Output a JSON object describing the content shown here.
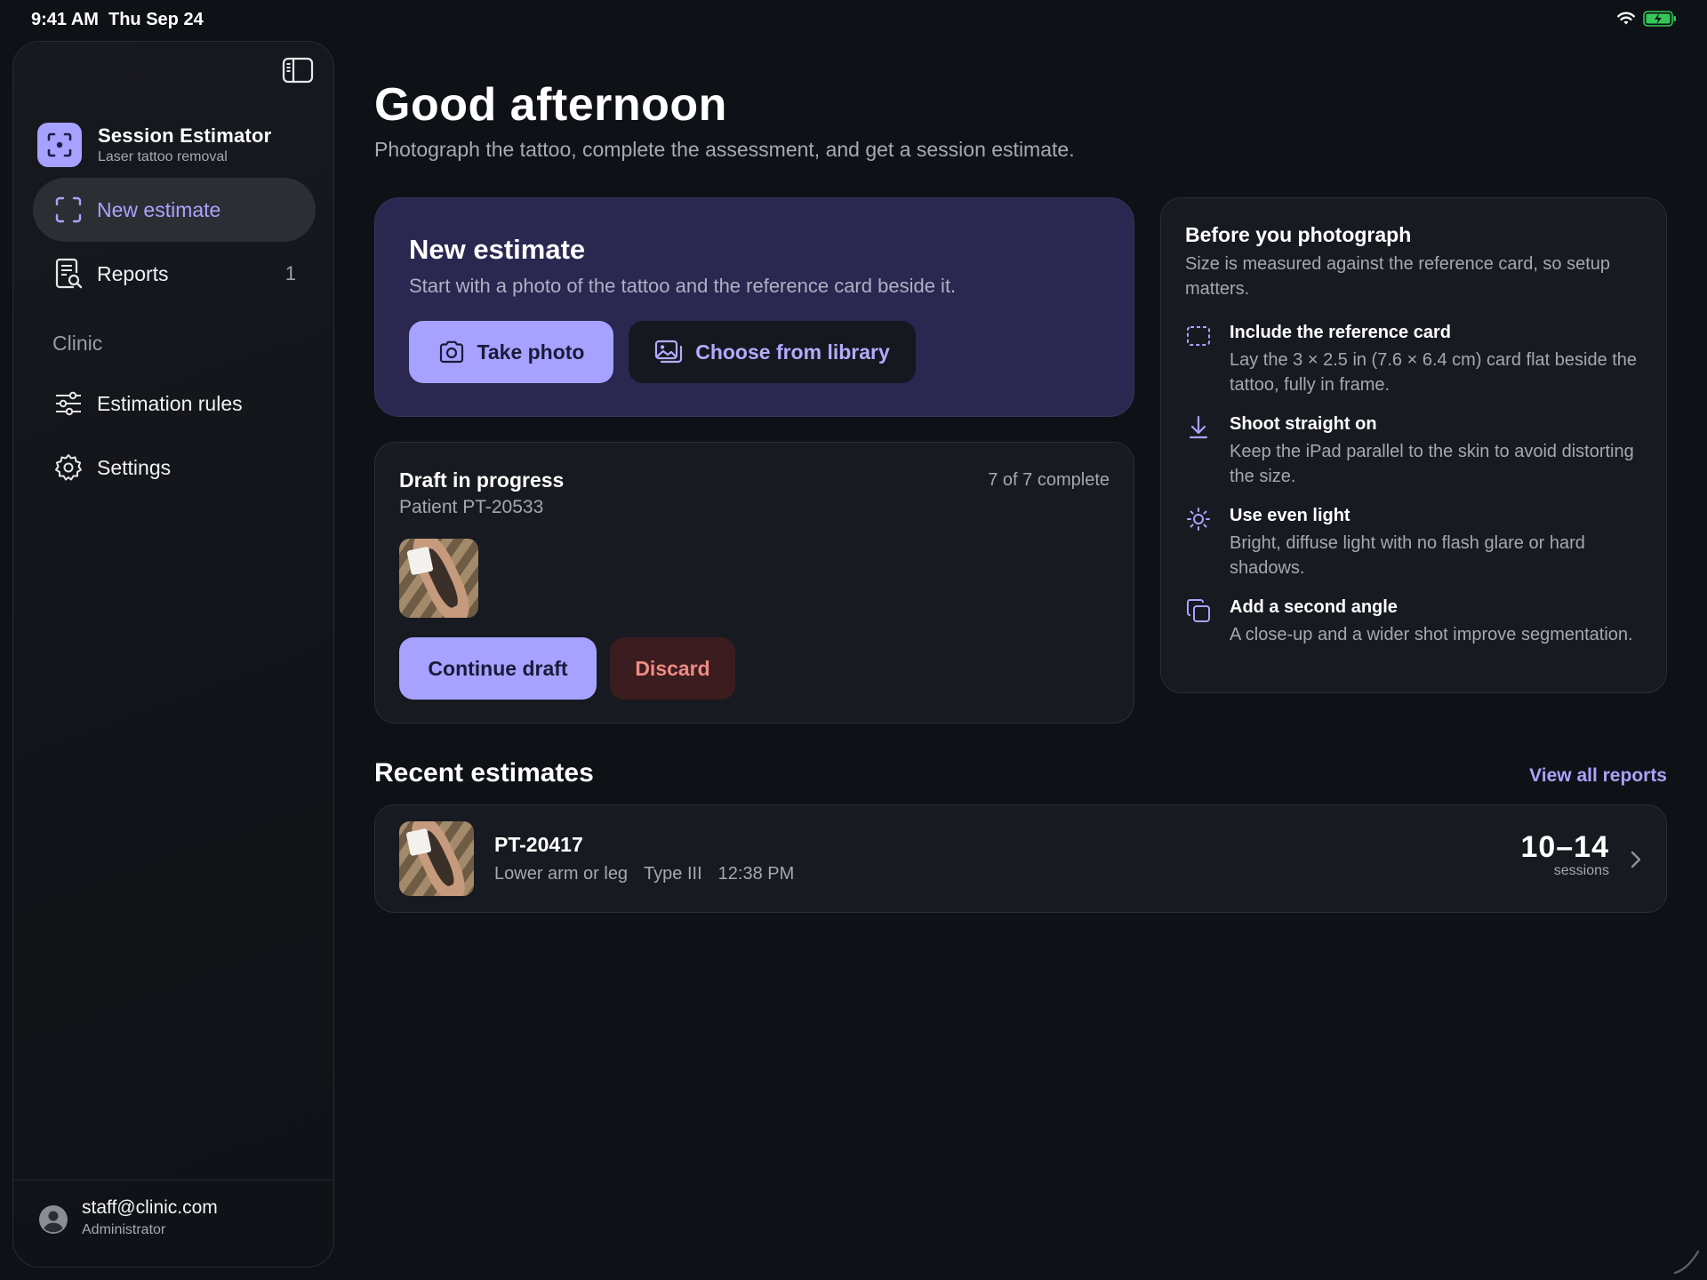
{
  "status_bar": {
    "time": "9:41 AM",
    "date": "Thu Sep 24"
  },
  "sidebar": {
    "brand_title": "Session Estimator",
    "brand_subtitle": "Laser tattoo removal",
    "nav": [
      {
        "label": "New estimate",
        "icon": "scan-frame-icon",
        "active": true
      },
      {
        "label": "Reports",
        "icon": "report-search-icon",
        "count": "1"
      }
    ],
    "section_label": "Clinic",
    "clinic_nav": [
      {
        "label": "Estimation rules",
        "icon": "sliders-icon"
      },
      {
        "label": "Settings",
        "icon": "gear-icon"
      }
    ],
    "user": {
      "email": "staff@clinic.com",
      "role": "Administrator"
    }
  },
  "main": {
    "greeting": "Good afternoon",
    "subtitle": "Photograph the tattoo, complete the assessment, and get a session estimate.",
    "new_estimate": {
      "title": "New estimate",
      "description": "Start with a photo of the tattoo and the reference card beside it.",
      "take_photo": "Take photo",
      "choose_library": "Choose from library"
    },
    "draft": {
      "title": "Draft in progress",
      "patient": "Patient PT-20533",
      "progress": "7 of 7 complete",
      "continue": "Continue draft",
      "discard": "Discard"
    },
    "tips": {
      "title": "Before you photograph",
      "description": "Size is measured against the reference card, so setup matters.",
      "items": [
        {
          "title": "Include the reference card",
          "text": "Lay the 3 × 2.5 in (7.6 × 6.4 cm) card flat beside the tattoo, fully in frame.",
          "icon": "dashed-card-icon"
        },
        {
          "title": "Shoot straight on",
          "text": "Keep the iPad parallel to the skin to avoid distorting the size.",
          "icon": "arrow-down-icon"
        },
        {
          "title": "Use even light",
          "text": "Bright, diffuse light with no flash glare or hard shadows.",
          "icon": "sun-icon"
        },
        {
          "title": "Add a second angle",
          "text": "A close-up and a wider shot improve segmentation.",
          "icon": "copy-icon"
        }
      ]
    },
    "recent": {
      "title": "Recent estimates",
      "view_all": "View all reports",
      "items": [
        {
          "id": "PT-20417",
          "area": "Lower arm or leg",
          "skin_type": "Type III",
          "time": "12:38 PM",
          "sessions": "10–14",
          "sessions_unit": "sessions"
        }
      ]
    }
  },
  "colors": {
    "accent": "#a7a2ff",
    "background": "#0e1116",
    "card": "#171a20",
    "hero": "#2a2750",
    "danger": "#f08a84"
  }
}
